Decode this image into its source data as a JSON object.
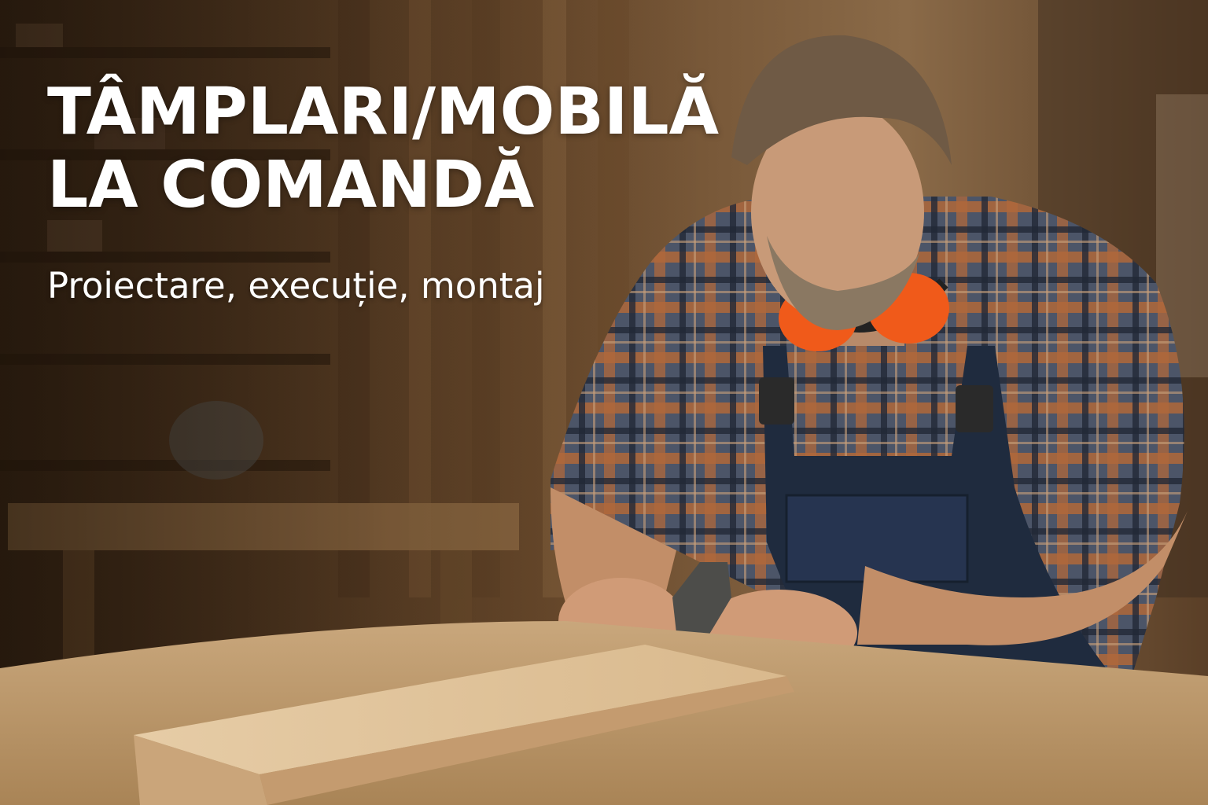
{
  "hero": {
    "headline_line1": "TÂMPLARI/MOBILĂ",
    "headline_line2": "LA COMANDĂ",
    "subtitle": "Proiectare, execuție, montaj"
  },
  "colors": {
    "text": "#ffffff",
    "ear_defenders": "#f05a1a",
    "apron": "#1f2b3e",
    "plank": "#e3c79f",
    "workshop_background": "#5a3d24"
  },
  "scene_elements": [
    "carpenter",
    "plaid-shirt",
    "apron",
    "ear-defenders",
    "wood-plank",
    "hand-plane",
    "workbench",
    "workshop-shelves"
  ]
}
